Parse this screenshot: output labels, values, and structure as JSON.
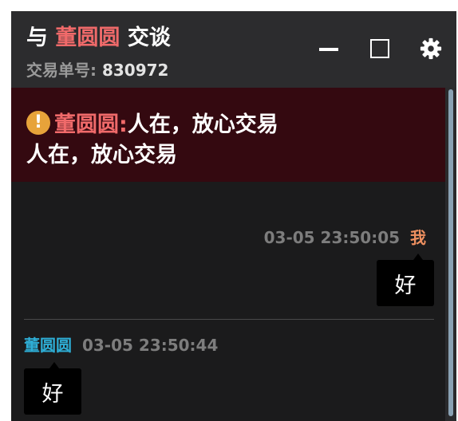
{
  "header": {
    "title_prefix": "与",
    "contact_name": "董圆圆",
    "title_suffix": "交谈",
    "order_label": "交易单号:",
    "order_number": "830972"
  },
  "controls": {
    "minimize_icon": "minimize-icon",
    "maximize_icon": "maximize-icon",
    "settings_icon": "gear-icon"
  },
  "notice": {
    "icon": "warning-icon",
    "sender": "董圆圆:",
    "headline": "人在，放心交易",
    "body": "人在，放心交易",
    "background": "#340910"
  },
  "messages": [
    {
      "side": "mine",
      "sender": "我",
      "time": "03-05 23:50:05",
      "text": "好"
    },
    {
      "side": "theirs",
      "sender": "董圆圆",
      "time": "03-05 23:50:44",
      "text": "好"
    }
  ],
  "colors": {
    "contact_name": "#f06a6a",
    "self_name": "#ef9060",
    "other_name": "#2eaed6",
    "warning": "#e7a33a"
  }
}
